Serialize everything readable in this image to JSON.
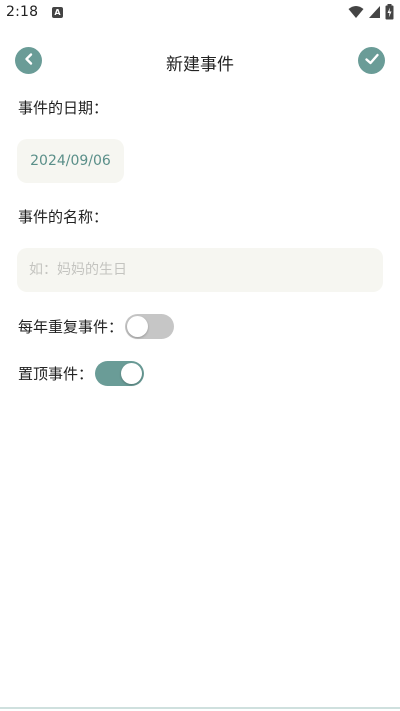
{
  "status_bar": {
    "time": "2:18",
    "notification_glyph": "A",
    "icons": [
      "wifi-icon",
      "signal-icon",
      "battery-charging-icon"
    ]
  },
  "header": {
    "title": "新建事件",
    "back_icon": "chevron-left-icon",
    "confirm_icon": "checkmark-icon"
  },
  "form": {
    "date_label": "事件的日期：",
    "date_value": "2024/09/06",
    "name_label": "事件的名称：",
    "name_value": "",
    "name_placeholder": "如：妈妈的生日",
    "repeat_label": "每年重复事件：",
    "repeat_enabled": false,
    "pin_label": "置顶事件：",
    "pin_enabled": true
  },
  "colors": {
    "accent": "#6a9c97",
    "field_background": "#f6f6f1",
    "toggle_off": "#c6c6c6",
    "date_text": "#5a8f89"
  }
}
